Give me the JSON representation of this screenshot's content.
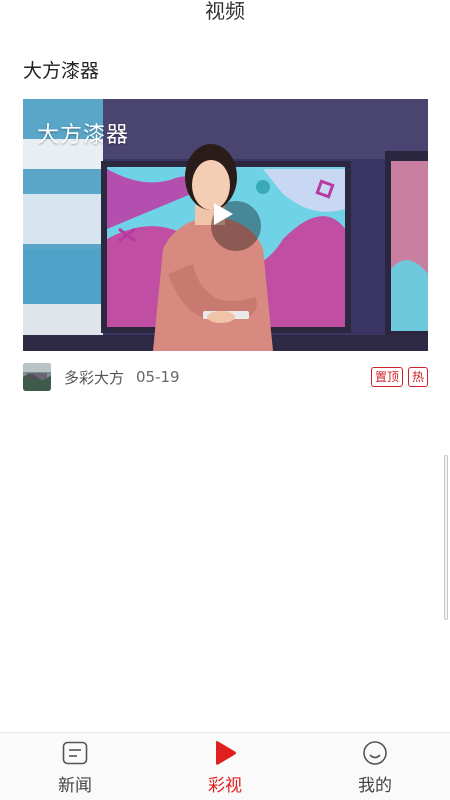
{
  "header": {
    "title": "视频"
  },
  "article": {
    "title": "大方漆器",
    "video": {
      "caption": "大方漆器",
      "play_icon": "play-icon"
    },
    "meta": {
      "source": "多彩大方",
      "date": "05-19",
      "tags": [
        "置顶",
        "热"
      ]
    }
  },
  "tabbar": {
    "items": [
      {
        "label": "新闻",
        "icon": "news-icon",
        "active": false
      },
      {
        "label": "彩视",
        "icon": "video-play-icon",
        "active": true
      },
      {
        "label": "我的",
        "icon": "smiley-icon",
        "active": false
      }
    ]
  },
  "colors": {
    "accent": "#e02020",
    "tag_red": "#d0222a"
  }
}
